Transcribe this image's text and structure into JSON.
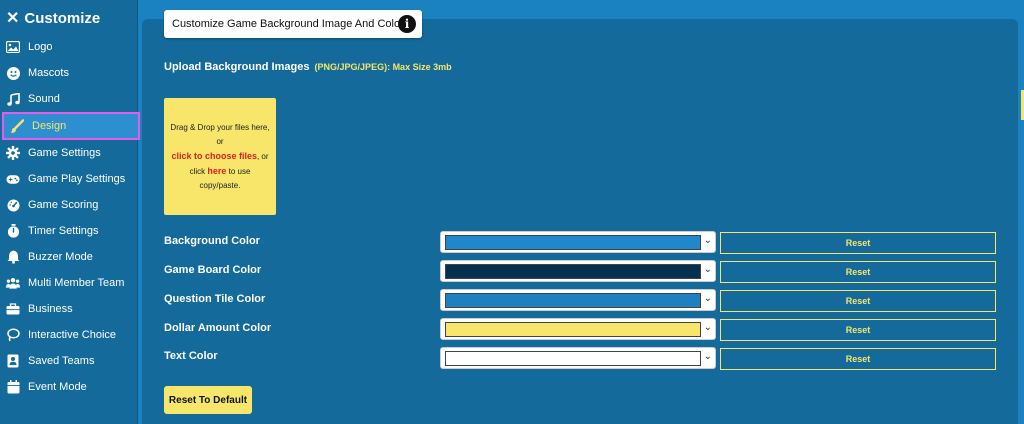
{
  "sidebar": {
    "title": "Customize",
    "close_glyph": "✕",
    "items": [
      {
        "label": "Logo",
        "icon": "image-icon"
      },
      {
        "label": "Mascots",
        "icon": "smiley-icon"
      },
      {
        "label": "Sound",
        "icon": "music-note-icon"
      },
      {
        "label": "Design",
        "icon": "paintbrush-icon",
        "active": true
      },
      {
        "label": "Game Settings",
        "icon": "gear-icon"
      },
      {
        "label": "Game Play Settings",
        "icon": "gamepad-icon"
      },
      {
        "label": "Game Scoring",
        "icon": "gauge-icon"
      },
      {
        "label": "Timer Settings",
        "icon": "stopwatch-icon"
      },
      {
        "label": "Buzzer Mode",
        "icon": "bell-icon"
      },
      {
        "label": "Multi Member Team",
        "icon": "users-icon"
      },
      {
        "label": "Business",
        "icon": "briefcase-icon"
      },
      {
        "label": "Interactive Choice",
        "icon": "lasso-icon"
      },
      {
        "label": "Saved Teams",
        "icon": "contact-card-icon"
      },
      {
        "label": "Event Mode",
        "icon": "calendar-icon"
      }
    ]
  },
  "main": {
    "title": "Customize Game Background Image And Colors",
    "info_glyph": "i",
    "upload": {
      "label": "Upload Background Images",
      "note": "(PNG/JPG/JPEG): Max Size 3mb",
      "drop_line1": "Drag & Drop your files here,",
      "drop_or": "or",
      "drop_choose": "click to choose files",
      "drop_comma_or": ", or",
      "drop_click": "click",
      "drop_here": "here",
      "drop_tail1": "to use",
      "drop_tail2": "copy/paste."
    },
    "colors": [
      {
        "label": "Background Color",
        "value": "#1f88cc",
        "reset": "Reset"
      },
      {
        "label": "Game Board Color",
        "value": "#05304e",
        "reset": "Reset"
      },
      {
        "label": "Question Tile Color",
        "value": "#1f7fbf",
        "reset": "Reset"
      },
      {
        "label": "Dollar Amount Color",
        "value": "#f7e66a",
        "reset": "Reset"
      },
      {
        "label": "Text Color",
        "value": "#ffffff",
        "reset": "Reset"
      }
    ],
    "reset_default": "Reset To Default"
  },
  "theme": {
    "accent_yellow": "#f7e66a",
    "panel_blue": "#136a9b",
    "page_blue": "#1a82c0",
    "highlight_pink": "#e85ae8"
  }
}
